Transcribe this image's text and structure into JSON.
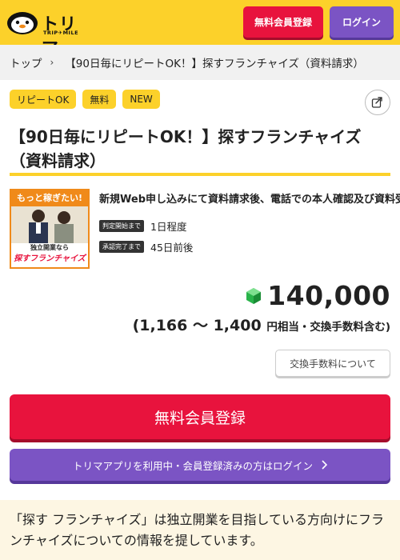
{
  "header": {
    "logo_text": "トリマ",
    "logo_sub": "TRIP✈MILE",
    "register_label": "無料会員登録",
    "login_label": "ログイン"
  },
  "breadcrumb": {
    "home": "トップ",
    "current": "【90日毎にリピートOK！】探すフランチャイズ（資料請求）"
  },
  "tags": [
    "リピートOK",
    "無料",
    "NEW"
  ],
  "title": "【90日毎にリピートOK！】探すフランチャイズ（資料請求）",
  "offer": {
    "thumb_top": "もっと稼ぎたい!",
    "thumb_bottom_1": "独立開業なら",
    "thumb_bottom_2": "探すフランチャイズ",
    "description": "新規Web申し込みにて資料請求後、電話での本人確認及び資料受",
    "judge_label": "判定開始まで",
    "judge_value": "1日程度",
    "approve_label": "承認完了まで",
    "approve_value": "45日前後"
  },
  "points": {
    "value": "140,000",
    "range_text": "(1,166 〜 1,400",
    "range_unit": "円相当・交換手数料含む)"
  },
  "buttons": {
    "fee_label": "交換手数料について",
    "register_big": "無料会員登録",
    "login_big": "トリマアプリを利用中・会員登録済みの方はログイン"
  },
  "info_text": "「探す フランチャイズ」は独立開業を目指している方向けにフランチャイズについての情報を提しています。",
  "colors": {
    "brand_yellow": "#fcd12a",
    "register_red": "#e8133d",
    "login_purple": "#7b54c4"
  }
}
